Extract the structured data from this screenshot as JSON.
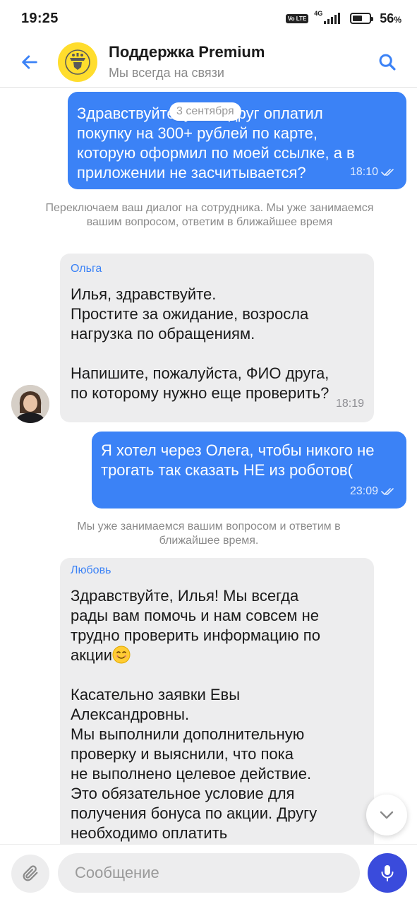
{
  "status": {
    "time": "19:25",
    "volte": "Vo LTE",
    "network": "4G",
    "battery_level": 0.56,
    "battery_pct": "56",
    "battery_unit": "%"
  },
  "header": {
    "title": "Поддержка Premium",
    "subtitle": "Мы всегда на связи"
  },
  "chat": {
    "date_pill": "3 сентября",
    "messages": [
      {
        "text": "Здравствуйте, у мой друг оплатил\nпокупку на 300+ рублей по карте,\nкоторую оформил по моей ссылке, а в\nприложении не засчитывается?",
        "time": "18:10"
      },
      {
        "text": "Переключаем ваш диалог на сотрудника. Мы уже занимаемся вашим вопросом, ответим в ближайшее время"
      },
      {
        "sender": "Ольга",
        "text": "Илья, здравствуйте.\nПростите за ожидание, возросла\nнагрузка по обращениям.\n\nНапишите, пожалуйста, ФИО друга,\nпо которому нужно еще проверить?",
        "time": "18:19"
      },
      {
        "text": "Я хотел через Олега, чтобы никого не\nтрогать так сказать НЕ из роботов(",
        "time": "23:09"
      },
      {
        "text": "Мы уже занимаемся вашим вопросом и ответим в ближайшее время."
      },
      {
        "sender": "Любовь",
        "text_part1": "Здравствуйте, Илья! Мы всегда\nрады вам помочь и нам совсем не\nтрудно проверить информацию по\nакции",
        "emoji": "smiling-face-emoji",
        "text_part2": "Касательно заявки Евы\nАлександровны.\nМы выполнили дополнительную\nпроверку и выяснили, что пока\nне выполнено целевое действие.\nЭто обязательное условие для\nполучения бонуса по акции. Другу\nнеобходимо оплатить"
      }
    ]
  },
  "input": {
    "placeholder": "Сообщение"
  },
  "colors": {
    "accent": "#3b82f6",
    "incoming_bubble": "#ededee",
    "mic_button": "#3a4bdc",
    "logo_yellow": "#ffdd2d"
  },
  "icons": {
    "back": "arrow-left-icon",
    "search": "search-icon",
    "attach": "paperclip-icon",
    "mic": "microphone-icon",
    "scroll": "chevron-down-icon",
    "read": "double-check-icon"
  }
}
